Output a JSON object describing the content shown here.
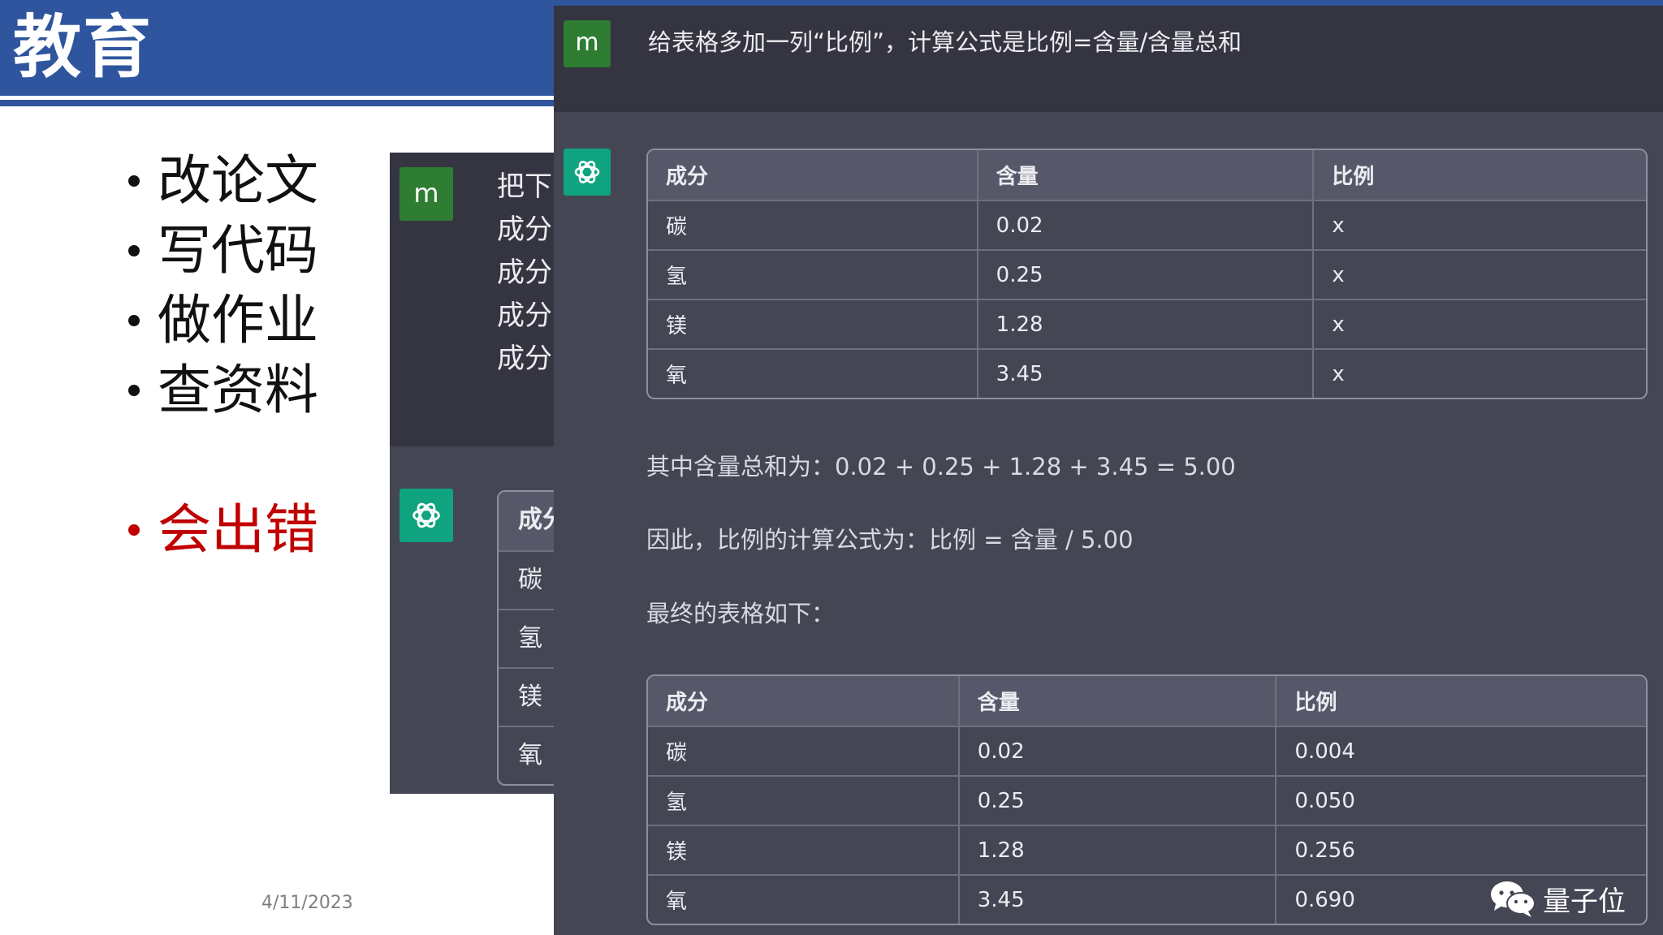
{
  "slide": {
    "title": "教育",
    "bullets": [
      "改论文",
      "写代码",
      "做作业",
      "查资料"
    ],
    "error_bullet": "会出错",
    "date": "4/11/2023",
    "colors": {
      "title_bar": "#2e559d",
      "error_text": "#c00000"
    }
  },
  "back_chat": {
    "user_avatar": "m",
    "user_lines": [
      "把下",
      "成分",
      "成分",
      "成分",
      "成分"
    ],
    "assistant_icon": "openai-logo-icon",
    "table_rows": [
      "成分",
      "碳",
      "氢",
      "镁",
      "氧"
    ]
  },
  "front_chat": {
    "user_avatar": "m",
    "prompt": "给表格多加一列“比例”，计算公式是比例=含量/含量总和",
    "assistant_icon": "openai-logo-icon",
    "table1": {
      "headers": [
        "成分",
        "含量",
        "比例"
      ],
      "rows": [
        [
          "碳",
          "0.02",
          "x"
        ],
        [
          "氢",
          "0.25",
          "x"
        ],
        [
          "镁",
          "1.28",
          "x"
        ],
        [
          "氧",
          "3.45",
          "x"
        ]
      ]
    },
    "paragraph1": "其中含量总和为：0.02 + 0.25 + 1.28 + 3.45 = 5.00",
    "paragraph2": "因此，比例的计算公式为：比例 = 含量 / 5.00",
    "paragraph3": "最终的表格如下：",
    "table2": {
      "headers": [
        "成分",
        "含量",
        "比例"
      ],
      "rows": [
        [
          "碳",
          "0.02",
          "0.004"
        ],
        [
          "氢",
          "0.25",
          "0.050"
        ],
        [
          "镁",
          "1.28",
          "0.256"
        ],
        [
          "氧",
          "3.45",
          "0.690"
        ]
      ]
    },
    "colors": {
      "user_bg": "#343541",
      "assistant_bg": "#444654",
      "gpt_avatar": "#10a37f",
      "user_avatar": "#2e7d32"
    }
  },
  "watermark": {
    "icon": "wechat-icon",
    "text": "量子位"
  }
}
